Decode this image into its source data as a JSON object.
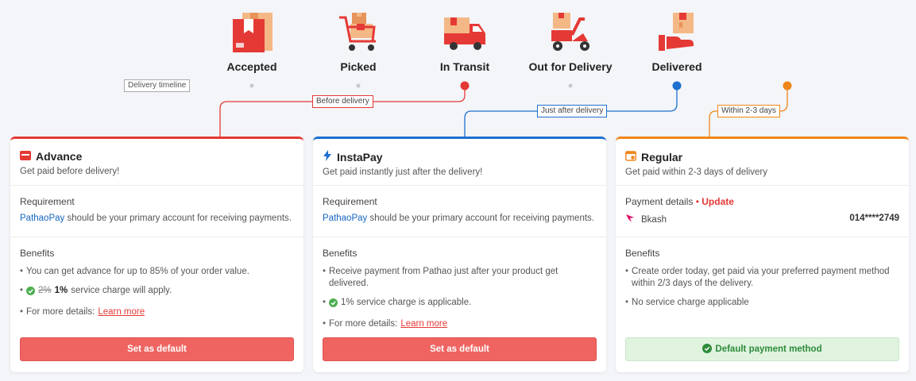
{
  "timeline": {
    "stages": [
      {
        "label": "Accepted",
        "icon": "box-icon"
      },
      {
        "label": "Picked",
        "icon": "trolley-icon"
      },
      {
        "label": "In Transit",
        "icon": "truck-icon"
      },
      {
        "label": "Out for Delivery",
        "icon": "scooter-icon"
      },
      {
        "label": "Delivered",
        "icon": "hand-box-icon"
      }
    ],
    "timeline_tag": "Delivery timeline",
    "before_tag": "Before delivery",
    "after_tag": "Just after delivery",
    "within_tag": "Within 2-3 days"
  },
  "colors": {
    "red": "#e53935",
    "blue": "#1e6fd0",
    "orange": "#f0861b",
    "button": "#ef6461",
    "default_bg": "#dff3df",
    "default_text": "#2e8b3a"
  },
  "cards": {
    "advance": {
      "title": "Advance",
      "subtitle": "Get paid before delivery!",
      "req_title": "Requirement",
      "req_link": "PathaoPay",
      "req_rest": " should be your primary account for receiving payments.",
      "benefits_title": "Benefits",
      "b1": "You can get advance for up to 85% of your order value.",
      "b2_old": "2%",
      "b2_new": "1%",
      "b2_rest": " service charge will apply.",
      "b3_prefix": "For more details: ",
      "b3_link": "Learn more",
      "button": "Set as default"
    },
    "instapay": {
      "title": "InstaPay",
      "subtitle": "Get paid instantly just after the delivery!",
      "req_title": "Requirement",
      "req_link": "PathaoPay",
      "req_rest": " should be your primary account for receiving payments.",
      "benefits_title": "Benefits",
      "b1": "Receive payment from Pathao just after your product get delivered.",
      "b2": "1% service charge is applicable.",
      "b3_prefix": "For more details: ",
      "b3_link": "Learn more",
      "button": "Set as default"
    },
    "regular": {
      "title": "Regular",
      "subtitle": "Get paid within 2-3 days of delivery",
      "pd_title": "Payment details",
      "pd_sep": " • ",
      "pd_update": "Update",
      "method": "Bkash",
      "account": "014****2749",
      "benefits_title": "Benefits",
      "b1": "Create order today, get paid via your preferred payment method within 2/3 days of the delivery.",
      "b2": "No service charge applicable",
      "button": "Default payment method"
    }
  }
}
